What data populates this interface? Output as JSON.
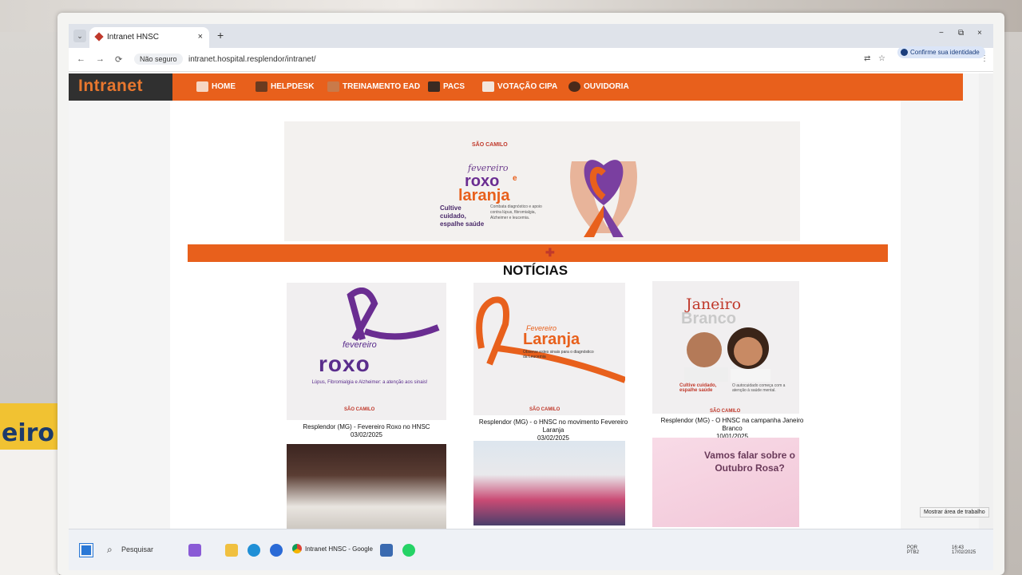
{
  "browser": {
    "tab_title": "Intranet HNSC",
    "new_tab": "+",
    "tab_close": "×",
    "tab_list": "⌄",
    "win_minimize": "−",
    "win_restore": "⧉",
    "win_close": "×",
    "back": "←",
    "forward": "→",
    "reload": "⟳",
    "security_label": "Não seguro",
    "url": "intranet.hospital.resplendor/intranet/",
    "translate_icon": "⇄",
    "bookmark_icon": "☆",
    "identity_label": "Confirme sua identidade",
    "menu_icon": "⋮"
  },
  "site": {
    "logo": "Intranet",
    "nav": [
      {
        "label": "HOME",
        "icon": "home-icon"
      },
      {
        "label": "HELPDESK",
        "icon": "helpdesk-icon"
      },
      {
        "label": "TREINAMENTO EAD",
        "icon": "training-icon"
      },
      {
        "label": "PACS",
        "icon": "pacs-icon"
      },
      {
        "label": "VOTAÇÃO CIPA",
        "icon": "vote-icon"
      },
      {
        "label": "OUVIDORIA",
        "icon": "ouvidoria-icon"
      }
    ],
    "banner": {
      "brand": "SÃO CAMILO",
      "subtitle": "fevereiro",
      "word1": "roxo",
      "conj": "e",
      "word2": "laranja",
      "slogan": "Cultive cuidado, espalhe saúde",
      "small_text": "Combata diagnóstico e apoio contra lúpus, fibromialgia, Alzheimer e leucemia."
    },
    "news_heading": "NOTÍCIAS",
    "news": [
      {
        "img_sub": "fevereiro",
        "img_main": "roxo",
        "img_line": "Lúpus, Fibromialgia e Alzheimer: a atenção aos sinais!",
        "img_brand": "SÃO CAMILO",
        "caption": "Resplendor (MG) - Fevereiro Roxo no HNSC",
        "date": "03/02/2025"
      },
      {
        "img_sub": "Fevereiro",
        "img_main": "Laranja",
        "img_line": "Observe estes sinais para o diagnóstico da Leucemia",
        "img_brand": "SÃO CAMILO",
        "caption": "Resplendor (MG) - o HNSC no movimento Fevereiro Laranja",
        "date": "03/02/2025"
      },
      {
        "img_main1": "Janeiro",
        "img_main2": "Branco",
        "img_slogan": "Cultive cuidado, espalhe saúde",
        "img_small": "O autocuidado começa com a atenção à saúde mental.",
        "img_brand": "SÃO CAMILO",
        "caption": "Resplendor (MG) - O HNSC na campanha Janeiro Branco",
        "date": "10/01/2025"
      },
      {
        "img_title": ""
      },
      {
        "img_title": ""
      },
      {
        "img_title": "Vamos falar sobre o Outubro Rosa?"
      }
    ]
  },
  "taskbar": {
    "search": "Pesquisar",
    "app_label": "Intranet HNSC - Google",
    "lang1": "POR",
    "lang2": "PTB2",
    "time": "16:43",
    "date": "17/02/2025",
    "desktop_tip": "Mostrar área de trabalho"
  },
  "surroundings": {
    "calendar_word": "eiro"
  },
  "colors": {
    "nav_orange": "#e8601c",
    "logo_bg": "#303030",
    "roxo": "#5a2d8c",
    "laranja": "#e8601c"
  }
}
